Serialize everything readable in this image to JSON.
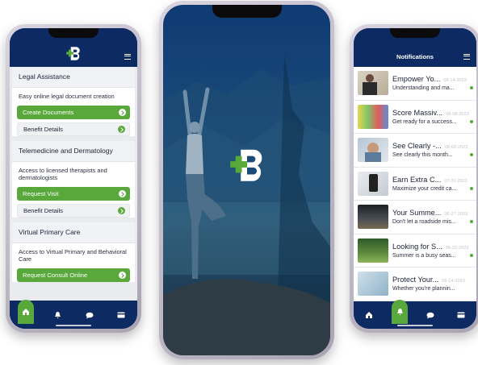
{
  "colors": {
    "navy": "#0d2a63",
    "green": "#58a83b",
    "card_bg": "#e9ebef"
  },
  "left_phone": {
    "services": [
      {
        "title": "Legal Assistance",
        "description": "Easy online legal document creation",
        "primary_action": "Create Documents",
        "secondary_action": "Benefit Details"
      },
      {
        "title": "Telemedicine and Dermatology",
        "description": "Access to licensed therapists and dermatologists",
        "primary_action": "Request Visit",
        "secondary_action": "Benefit Details"
      },
      {
        "title": "Virtual Primary Care",
        "description": "Access to Virtual Primary and Behavioral Care",
        "primary_action": "Request Consult Online",
        "secondary_action": ""
      }
    ],
    "tabs": [
      "home-icon",
      "bell-icon",
      "chat-icon",
      "card-icon"
    ]
  },
  "right_phone": {
    "title": "Notifications",
    "notifications": [
      {
        "title": "Empower Yo...",
        "date": "08-14-2023",
        "body": "Understanding and ma..."
      },
      {
        "title": "Score Massiv...",
        "date": "08-08-2023",
        "body": "Get ready for a success..."
      },
      {
        "title": "See Clearly -...",
        "date": "08-02-2023",
        "body": "See clearly this month..."
      },
      {
        "title": "Earn Extra C...",
        "date": "07-31-2023",
        "body": "Maximize your credit ca..."
      },
      {
        "title": "Your Summe...",
        "date": "06-27-2023",
        "body": "Don't let a roadside mis..."
      },
      {
        "title": "Looking for S...",
        "date": "06-22-2023",
        "body": "Summer is a busy seas..."
      },
      {
        "title": "Protect Your...",
        "date": "06-14-2023",
        "body": "Whether you're plannin..."
      }
    ],
    "tabs": [
      "home-icon",
      "bell-icon",
      "chat-icon",
      "card-icon"
    ]
  }
}
